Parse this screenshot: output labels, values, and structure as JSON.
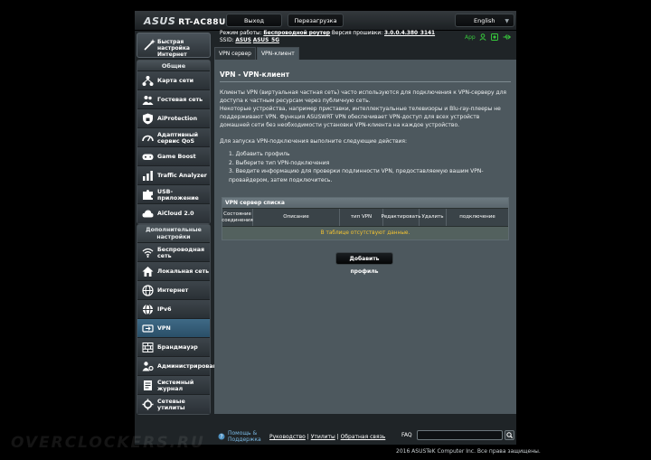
{
  "header": {
    "brand": "ASUS",
    "model": "RT-AC88U",
    "logout_label": "Выход",
    "reboot_label": "Перезагрузка",
    "language": "English"
  },
  "status": {
    "mode_label": "Режим работы:",
    "mode_value": "Беспроводной роутер",
    "firmware_label": "Версия прошивки:",
    "firmware_value": "3.0.0.4.380_3141",
    "ssid_label": "SSID:",
    "ssid_1": "ASUS",
    "ssid_2": "ASUS_5G",
    "app_label": "App"
  },
  "sidebar": {
    "quick_setup": "Быстрая настройка Интернет",
    "general_title": "Общие",
    "general_items": [
      {
        "label": "Карта сети",
        "icon": "network-map-icon"
      },
      {
        "label": "Гостевая сеть",
        "icon": "guest-network-icon"
      },
      {
        "label": "AiProtection",
        "icon": "shield-icon"
      },
      {
        "label": "Адаптивный сервис QoS",
        "icon": "qos-gauge-icon"
      },
      {
        "label": "Game Boost",
        "icon": "gamepad-icon"
      },
      {
        "label": "Traffic Analyzer",
        "icon": "traffic-analyzer-icon"
      },
      {
        "label": "USB-приложение",
        "icon": "puzzle-icon"
      },
      {
        "label": "AiCloud 2.0",
        "icon": "cloud-icon"
      }
    ],
    "advanced_title": "Дополнительные настройки",
    "advanced_items": [
      {
        "label": "Беспроводная сеть",
        "icon": "wireless-icon"
      },
      {
        "label": "Локальная сеть",
        "icon": "home-icon"
      },
      {
        "label": "Интернет",
        "icon": "globe-icon"
      },
      {
        "label": "IPv6",
        "icon": "ipv6-globe-icon"
      },
      {
        "label": "VPN",
        "icon": "vpn-icon"
      },
      {
        "label": "Брандмауэр",
        "icon": "firewall-icon"
      },
      {
        "label": "Администрирование",
        "icon": "administration-icon"
      },
      {
        "label": "Системный журнал",
        "icon": "system-log-icon"
      },
      {
        "label": "Сетевые утилиты",
        "icon": "network-tools-icon"
      }
    ],
    "active_item": "VPN"
  },
  "tabs": [
    {
      "label": "VPN сервер",
      "active": false
    },
    {
      "label": "VPN-клиент",
      "active": true
    }
  ],
  "content": {
    "title": "VPN - VPN-клиент",
    "para1": "Клиенты VPN (виртуальная частная сеть) часто используются для подключения к VPN-серверу для доступа к частным ресурсам через публичную сеть.",
    "para2": "Некоторые устройства, например приставки, интеллектуальные телевизоры и Blu-ray-плееры не поддерживают VPN. Функция ASUSWRT VPN обеспечивает VPN-доступ для всех устройств домашней сети без необходимости установки VPN-клиента на каждое устройство.",
    "para3": "Для запуска VPN-подключения выполните следующие действия:",
    "steps": [
      "1. Добавить профиль",
      "2. Выберите тип VPN-подключения",
      "3. Введите информацию для проверки подлинности VPN, предоставляемую вашим VPN-провайдером, затем подключитесь."
    ],
    "table_title": "VPN сервер списка",
    "columns": [
      "Состояние соединения",
      "Описание",
      "тип VPN",
      "Редактировать",
      "Удалить",
      "подключение"
    ],
    "no_data": "В таблице отсутствуют данные.",
    "add_profile": "Добавить профиль"
  },
  "footer": {
    "help": "Помощь & Поддержка",
    "link_manual": "Руководство",
    "link_utilities": "Утилиты",
    "link_feedback": "Обратная связь",
    "separator": "|",
    "faq": "FAQ",
    "copyright": "2016 ASUSTeK Computer Inc. Все права защищены.",
    "watermark": "OVERCLOCKERS.RU"
  },
  "colors": {
    "background": "#000000",
    "panel": "#4d585e",
    "active_nav": "#3f6a86",
    "accent_green": "#36c53b",
    "no_data_yellow": "#f5c431",
    "help_blue": "#7ab9e4"
  }
}
